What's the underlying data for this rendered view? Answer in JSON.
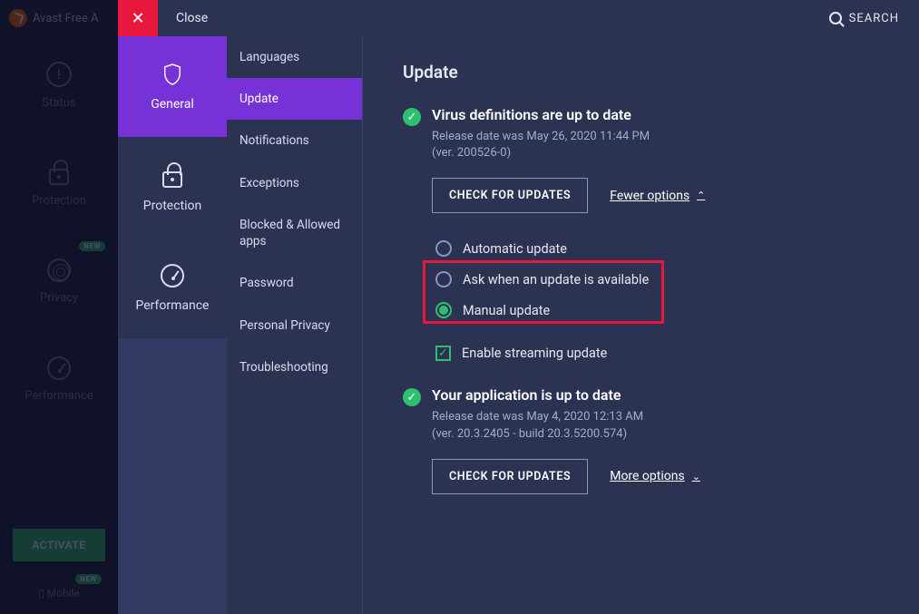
{
  "brand": "Avast Free A",
  "bg_nav": {
    "status": "Status",
    "protection": "Protection",
    "privacy": "Privacy",
    "performance": "Performance",
    "badge_new": "NEW",
    "activate": "ACTIVATE",
    "mobile": "Mobile"
  },
  "topbar": {
    "close": "Close",
    "search": "SEARCH"
  },
  "categories": {
    "general": "General",
    "protection": "Protection",
    "performance": "Performance"
  },
  "submenu": {
    "languages": "Languages",
    "update": "Update",
    "notifications": "Notifications",
    "exceptions": "Exceptions",
    "blocked": "Blocked & Allowed apps",
    "password": "Password",
    "privacy": "Personal Privacy",
    "troubleshoot": "Troubleshooting"
  },
  "content": {
    "heading": "Update",
    "defs_title": "Virus definitions are up to date",
    "defs_sub1": "Release date was May 26, 2020 11:44 PM",
    "defs_sub2": "(ver. 200526-0)",
    "check_updates": "CHECK FOR UPDATES",
    "fewer_options": "Fewer options",
    "radio_auto": "Automatic update",
    "radio_ask": "Ask when an update is available",
    "radio_manual": "Manual update",
    "enable_streaming": "Enable streaming update",
    "app_title": "Your application is up to date",
    "app_sub1": "Release date was May 4, 2020 12:13 AM",
    "app_sub2": "(ver. 20.3.2405 - build 20.3.5200.574)",
    "more_options": "More options"
  }
}
